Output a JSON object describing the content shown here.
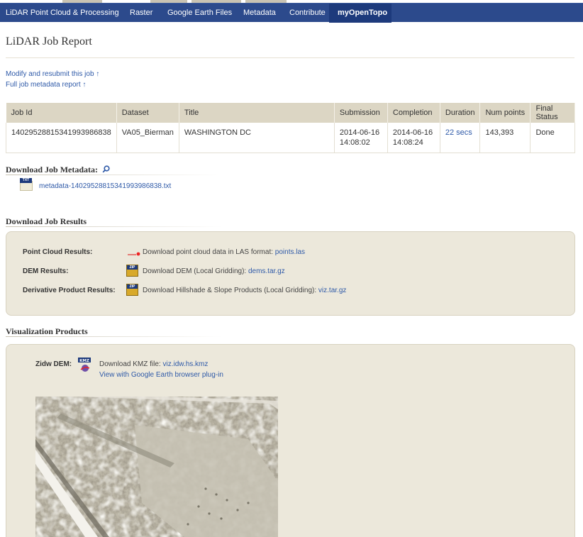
{
  "nav": {
    "items": [
      {
        "label": "LiDAR Point Cloud & Processing"
      },
      {
        "label": "Raster"
      },
      {
        "label": "Google Earth Files"
      },
      {
        "label": "Metadata"
      },
      {
        "label": "Contribute"
      },
      {
        "label": "myOpenTopo",
        "active": true
      }
    ]
  },
  "page": {
    "title": "LiDAR Job Report",
    "links": [
      "Modify and resubmit this job ↑",
      "Full job metadata report ↑"
    ]
  },
  "job_table": {
    "headers": [
      "Job Id",
      "Dataset",
      "Title",
      "Submission",
      "Completion",
      "Duration",
      "Num points",
      "Final Status"
    ],
    "row": {
      "job_id": "14029528815341993986838",
      "dataset": "VA05_Bierman",
      "title": "WASHINGTON DC",
      "submission_date": "2014-06-16",
      "submission_time": "14:08:02",
      "completion_date": "2014-06-16",
      "completion_time": "14:08:24",
      "duration": "22 secs",
      "num_points": "143,393",
      "final_status": "Done"
    }
  },
  "download_metadata": {
    "heading": "Download Job Metadata:",
    "file": "metadata-14029528815341993986838.txt"
  },
  "download_results": {
    "heading": "Download Job Results",
    "rows": [
      {
        "label": "Point Cloud Results:",
        "text": "Download point cloud data in LAS format:",
        "link": "points.las",
        "icon": "point-cloud-icon"
      },
      {
        "label": "DEM Results:",
        "text": "Download DEM (Local Gridding):",
        "link": "dems.tar.gz",
        "icon": "zip-icon"
      },
      {
        "label": "Derivative Product Results:",
        "text": "Download Hillshade & Slope Products (Local Gridding):",
        "link": "viz.tar.gz",
        "icon": "zip-icon"
      }
    ]
  },
  "visualization": {
    "heading": "Visualization Products",
    "label": "Zidw DEM:",
    "kmz_text": "Download KMZ file:",
    "kmz_link": "viz.idw.hs.kmz",
    "plugin_link": "View with Google Earth browser plug-in"
  },
  "colors": {
    "nav_bg": "#2c4a8c",
    "panel_bg": "#ece8db",
    "table_header_bg": "#dcd6c4",
    "link": "#2f5aa8"
  }
}
